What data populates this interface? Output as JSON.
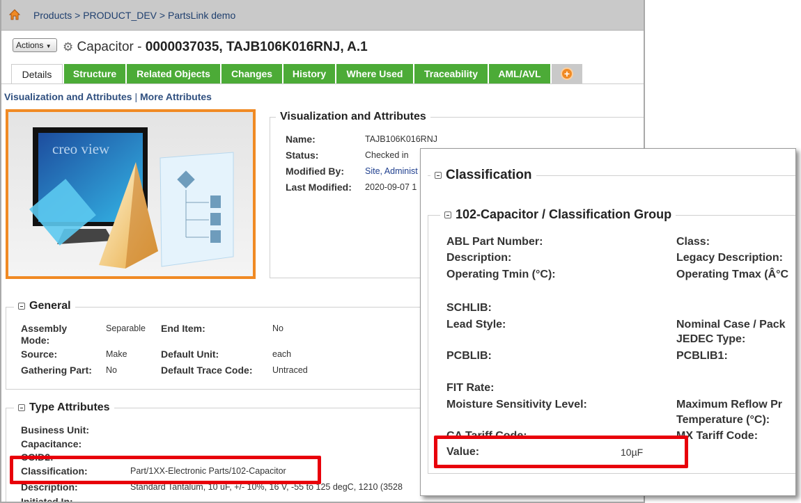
{
  "breadcrumb": {
    "items": [
      "Products",
      "PRODUCT_DEV",
      "PartsLink demo"
    ],
    "sep": ">"
  },
  "header": {
    "actions_label": "Actions",
    "type": "Capacitor",
    "dash": " - ",
    "identity": "0000037035, TAJB106K016RNJ, A.1"
  },
  "tabs": [
    "Details",
    "Structure",
    "Related Objects",
    "Changes",
    "History",
    "Where Used",
    "Traceability",
    "AML/AVL"
  ],
  "subnav": {
    "link1": "Visualization and Attributes",
    "sep": "|",
    "link2": "More Attributes"
  },
  "viewer": {
    "brand": "creo view"
  },
  "vis": {
    "title": "Visualization and Attributes",
    "rows": [
      {
        "label": "Name:",
        "value": "TAJB106K016RNJ"
      },
      {
        "label": "Status:",
        "value": "Checked in"
      },
      {
        "label": "Modified By:",
        "value": "Site, Administ"
      },
      {
        "label": "Last Modified:",
        "value": "2020-09-07 1"
      }
    ]
  },
  "general": {
    "title": "General",
    "rows": [
      {
        "label": "Assembly Mode:",
        "value": "Separable",
        "label2": "End Item:",
        "value2": "No"
      },
      {
        "label": "Source:",
        "value": "Make",
        "label2": "Default Unit:",
        "value2": "each"
      },
      {
        "label": "Gathering Part:",
        "value": "No",
        "label2": "Default Trace Code:",
        "value2": "Untraced"
      }
    ]
  },
  "type_attributes": {
    "title": "Type Attributes",
    "rows": [
      {
        "label": "Business Unit:",
        "value": ""
      },
      {
        "label": "Capacitance:",
        "value": ""
      },
      {
        "label": "CCID2:",
        "value": ""
      },
      {
        "label": "Classification:",
        "value": "Part/1XX-Electronic Parts/102-Capacitor"
      },
      {
        "label": "Description:",
        "value": "Standard Tantalum, 10 uF, +/- 10%, 16 V, -55 to 125 degC, 1210 (3528"
      },
      {
        "label": "Initiated In:",
        "value": ""
      }
    ]
  },
  "classification": {
    "title": "Classification",
    "group_title": "102-Capacitor / Classification Group",
    "left": [
      "ABL Part Number:",
      "Description:",
      "Operating Tmin (°C):",
      "SCHLIB:",
      "Lead Style:",
      "PCBLIB:",
      "FIT Rate:",
      "Moisture Sensitivity Level:",
      "CA Tariff Code:",
      "Value:"
    ],
    "right": [
      "Class:",
      "Legacy Description:",
      "Operating Tmax (Â°C",
      "Nominal Case / Pack",
      "JEDEC Type:",
      "PCBLIB1:",
      "Maximum Reflow Pr",
      "Temperature (°C):",
      "MX Tariff Code:"
    ],
    "value_value": "10µF"
  },
  "colors": {
    "tab_green": "#4cab37",
    "highlight": "#e8000b",
    "image_border": "#f08a24"
  }
}
